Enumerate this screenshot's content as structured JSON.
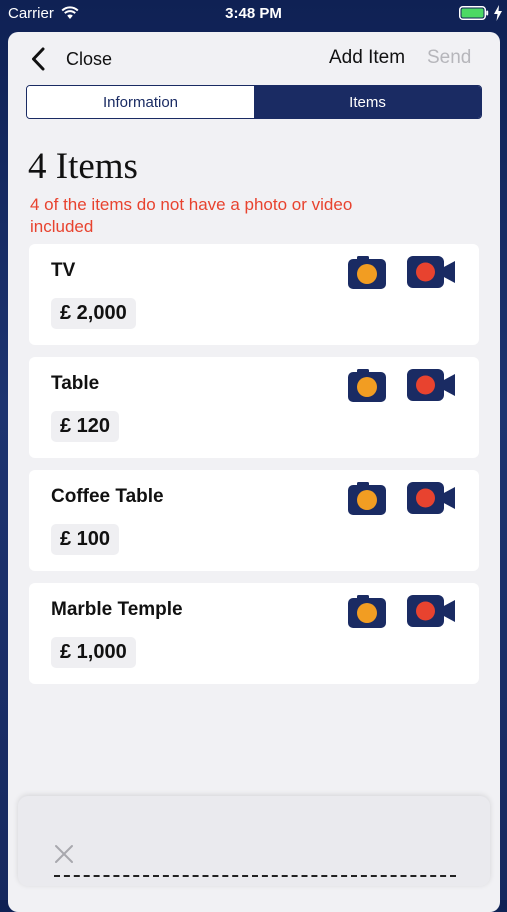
{
  "status_bar": {
    "carrier": "Carrier",
    "time": "3:48 PM"
  },
  "nav": {
    "close_label": "Close",
    "add_item_label": "Add Item",
    "send_label": "Send"
  },
  "segments": {
    "information_label": "Information",
    "items_label": "Items",
    "selected": "Items"
  },
  "summary": {
    "title": "4 Items",
    "warning": "4 of the items do not have a photo or video included"
  },
  "items": [
    {
      "name": "TV",
      "price": "£ 2,000"
    },
    {
      "name": "Table",
      "price": "£ 120"
    },
    {
      "name": "Coffee Table",
      "price": "£ 100"
    },
    {
      "name": "Marble Temple",
      "price": "£ 1,000"
    }
  ],
  "icons": {
    "back": "chevron-left-icon",
    "photo": "camera-icon",
    "video": "video-camera-icon",
    "dismiss": "close-icon"
  },
  "colors": {
    "navy": "#1a2b63",
    "warning": "#e8432f",
    "photo_lens": "#f29d22",
    "video_dot": "#e8432f",
    "send_disabled": "#b6b6bb"
  }
}
